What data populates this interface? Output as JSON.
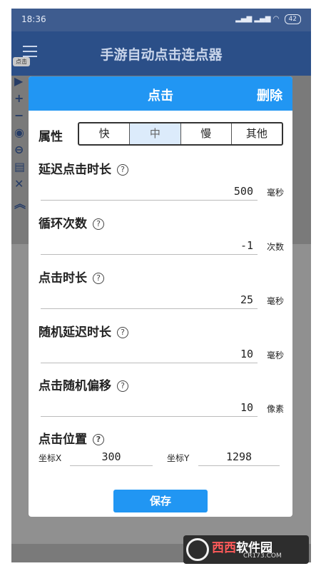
{
  "status_bar": {
    "time": "18:36",
    "battery": "42"
  },
  "app_bar": {
    "title": "手游自动点击连点器"
  },
  "background": {
    "tag": "点击"
  },
  "dialog": {
    "title": "点击",
    "delete_label": "删除",
    "attr_label": "属性",
    "speed_options": [
      "快",
      "中",
      "慢",
      "其他"
    ],
    "selected_speed": "中",
    "fields": [
      {
        "label": "延迟点击时长",
        "value": "500",
        "unit": "毫秒"
      },
      {
        "label": "循环次数",
        "value": "-1",
        "unit": "次数"
      },
      {
        "label": "点击时长",
        "value": "25",
        "unit": "毫秒"
      },
      {
        "label": "随机延迟时长",
        "value": "10",
        "unit": "毫秒"
      },
      {
        "label": "点击随机偏移",
        "value": "10",
        "unit": "像素"
      }
    ],
    "position": {
      "label": "点击位置",
      "x_label": "坐标X",
      "x_value": "300",
      "y_label": "坐标Y",
      "y_value": "1298"
    },
    "help_glyph": "?",
    "save_label": "保存"
  },
  "watermark": {
    "brand_hi": "西西",
    "brand_rest": "软件园",
    "url": "CR173.COM"
  },
  "colors": {
    "accent": "#2196f3",
    "appbar": "#2b4f88",
    "selected_segment": "#dcebfb"
  }
}
